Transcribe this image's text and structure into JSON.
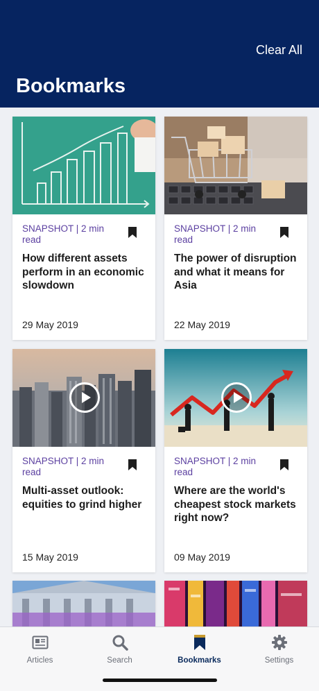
{
  "header": {
    "title": "Bookmarks",
    "clear_all_label": "Clear All"
  },
  "cards": [
    {
      "meta": "SNAPSHOT | 2 min read",
      "title": "How different assets perform in an economic slowdown",
      "date": "29 May 2019",
      "image_icon": "chalkboard-chart-image",
      "has_video": false
    },
    {
      "meta": "SNAPSHOT | 2 min read",
      "title": "The power of disruption and what it means for Asia",
      "date": "22 May 2019",
      "image_icon": "shopping-cart-keyboard-image",
      "has_video": false
    },
    {
      "meta": "SNAPSHOT | 2 min read",
      "title": "Multi-asset outlook: equities to grind higher",
      "date": "15 May 2019",
      "image_icon": "city-skyline-image",
      "has_video": true
    },
    {
      "meta": "SNAPSHOT | 2 min read",
      "title": "Where are the world's cheapest stock markets right now?",
      "date": "09 May 2019",
      "image_icon": "people-lifting-arrow-image",
      "has_video": true
    }
  ],
  "tabs": [
    {
      "label": "Articles",
      "icon": "newspaper-icon",
      "active": false
    },
    {
      "label": "Search",
      "icon": "search-icon",
      "active": false
    },
    {
      "label": "Bookmarks",
      "icon": "bookmark-icon",
      "active": true
    },
    {
      "label": "Settings",
      "icon": "gear-icon",
      "active": false
    }
  ],
  "colors": {
    "header_bg": "#062460",
    "meta_text": "#5b3fa0",
    "active_tab": "#0a2a5c"
  }
}
